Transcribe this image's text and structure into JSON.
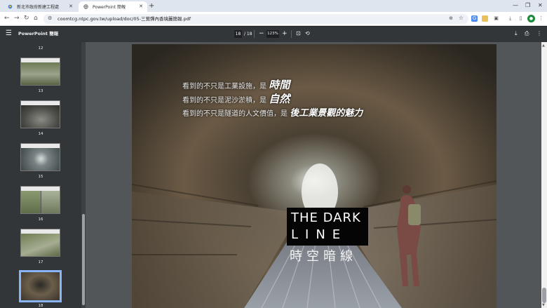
{
  "tabs": [
    {
      "title": "新北市政府新建工程處",
      "active": false
    },
    {
      "title": "PowerPoint 簡報",
      "active": true
    }
  ],
  "address_bar": {
    "url": "coomtcg.ntpc.gov.tw/upload/doc/05-三鶯彈內香境麗簡報.pdf"
  },
  "pdf_toolbar": {
    "title": "PowerPoint 簡報",
    "current_page": "18",
    "page_separator": "/ 18",
    "zoom": "123%"
  },
  "thumbnails": [
    {
      "page": "12"
    },
    {
      "page": "13"
    },
    {
      "page": "14"
    },
    {
      "page": "15"
    },
    {
      "page": "16"
    },
    {
      "page": "17"
    },
    {
      "page": "18",
      "selected": true
    }
  ],
  "slide": {
    "line1_text": "看到的不只是工業設施，是",
    "line1_highlight": "時間",
    "line2_text": "看到的不只是泥沙淤積，是",
    "line2_highlight": "自然",
    "line3_text": "看到的不只是隧道的人文價值，是",
    "line3_highlight": "後工業景觀的魅力",
    "logo_line1": "THE DARK",
    "logo_line2": "LINE",
    "logo_subtitle": "時空暗線"
  },
  "colors": {
    "tabstrip": "#dfe5ee",
    "pdf_toolbar": "#323639",
    "viewer_bg": "#525659",
    "selected_thumb_border": "#8ab4f8"
  }
}
